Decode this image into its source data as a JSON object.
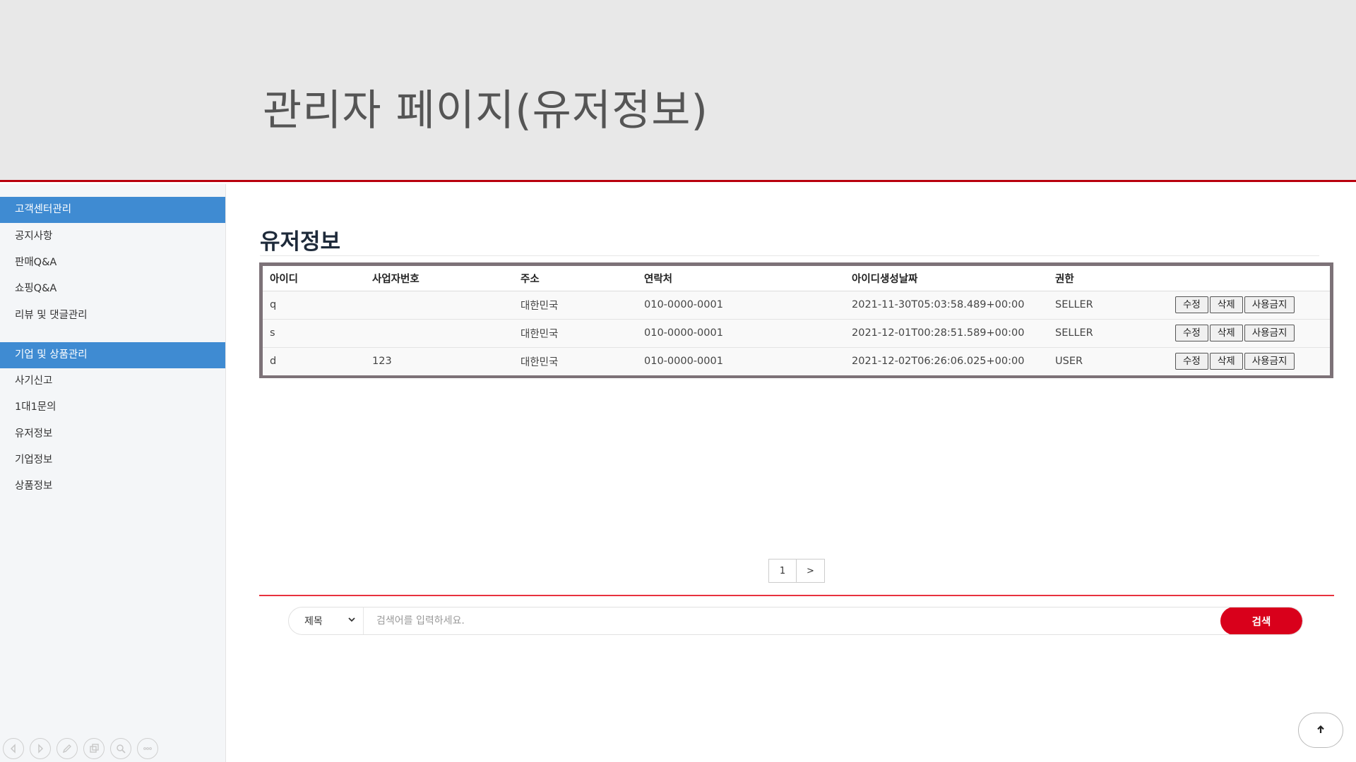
{
  "header": {
    "title": "관리자 페이지(유저정보)"
  },
  "sidebar": {
    "groups": [
      {
        "label": "고객센터관리",
        "items": [
          "공지사항",
          "판매Q&A",
          "쇼핑Q&A",
          "리뷰 및 댓글관리"
        ]
      },
      {
        "label": "기업 및 상품관리",
        "items": [
          "사기신고",
          "1대1문의",
          "유저정보",
          "기업정보",
          "상품정보"
        ]
      }
    ]
  },
  "main": {
    "section_title": "유저정보",
    "table": {
      "columns": [
        "아이디",
        "사업자번호",
        "주소",
        "연락처",
        "아이디생성날짜",
        "권한"
      ],
      "rows": [
        {
          "id": "q",
          "biz": "",
          "addr": "대한민국",
          "phone": "010-0000-0001",
          "created": "2021-11-30T05:03:58.489+00:00",
          "role": "SELLER"
        },
        {
          "id": "s",
          "biz": "",
          "addr": "대한민국",
          "phone": "010-0000-0001",
          "created": "2021-12-01T00:28:51.589+00:00",
          "role": "SELLER"
        },
        {
          "id": "d",
          "biz": "123",
          "addr": "대한민국",
          "phone": "010-0000-0001",
          "created": "2021-12-02T06:26:06.025+00:00",
          "role": "USER"
        }
      ],
      "actions": {
        "edit": "수정",
        "delete": "삭제",
        "ban": "사용금지"
      }
    },
    "pager": {
      "current": "1",
      "next": ">"
    },
    "search": {
      "field": "제목",
      "placeholder": "검색어를 입력하세요.",
      "button": "검색"
    }
  },
  "icons": [
    "arrow-left-icon",
    "arrow-right-icon",
    "pen-icon",
    "copy-icon",
    "zoom-icon",
    "more-icon",
    "arrow-up-icon"
  ],
  "colors": {
    "accent_red": "#d9001b",
    "sidebar_active": "#3f8bd2",
    "banner_bg": "#e8e8e8"
  }
}
